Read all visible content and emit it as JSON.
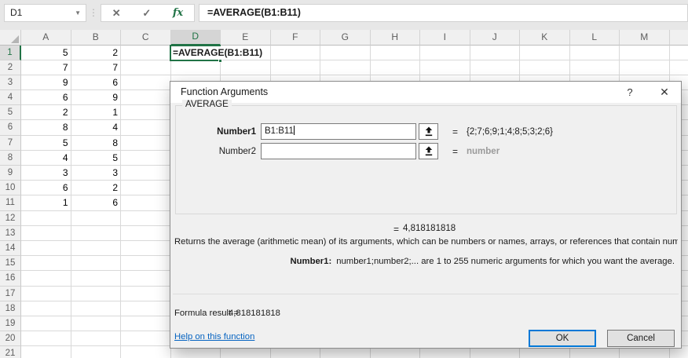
{
  "formula_bar": {
    "name_box": "D1",
    "cancel_icon": "✕",
    "enter_icon": "✓",
    "insert_function_icon": "fx",
    "formula": "=AVERAGE(B1:B11)"
  },
  "grid": {
    "columns": [
      "A",
      "B",
      "C",
      "D",
      "E",
      "F",
      "G",
      "H",
      "I",
      "J",
      "K",
      "L",
      "M"
    ],
    "active_column": "D",
    "active_row": "1",
    "active_cell_text": "=AVERAGE(B1:B11)",
    "rows": [
      {
        "n": "1",
        "a": "5",
        "b": "2"
      },
      {
        "n": "2",
        "a": "7",
        "b": "7"
      },
      {
        "n": "3",
        "a": "9",
        "b": "6"
      },
      {
        "n": "4",
        "a": "6",
        "b": "9"
      },
      {
        "n": "5",
        "a": "2",
        "b": "1"
      },
      {
        "n": "6",
        "a": "8",
        "b": "4"
      },
      {
        "n": "7",
        "a": "5",
        "b": "8"
      },
      {
        "n": "8",
        "a": "4",
        "b": "5"
      },
      {
        "n": "9",
        "a": "3",
        "b": "3"
      },
      {
        "n": "10",
        "a": "6",
        "b": "2"
      },
      {
        "n": "11",
        "a": "1",
        "b": "6"
      },
      {
        "n": "12",
        "a": "",
        "b": ""
      },
      {
        "n": "13",
        "a": "",
        "b": ""
      },
      {
        "n": "14",
        "a": "",
        "b": ""
      },
      {
        "n": "15",
        "a": "",
        "b": ""
      },
      {
        "n": "16",
        "a": "",
        "b": ""
      },
      {
        "n": "17",
        "a": "",
        "b": ""
      },
      {
        "n": "18",
        "a": "",
        "b": ""
      },
      {
        "n": "19",
        "a": "",
        "b": ""
      },
      {
        "n": "20",
        "a": "",
        "b": ""
      },
      {
        "n": "21",
        "a": "",
        "b": ""
      }
    ]
  },
  "dialog": {
    "title": "Function Arguments",
    "help_button": "?",
    "close_button": "✕",
    "group_label": "AVERAGE",
    "fields": {
      "number1": {
        "label": "Number1",
        "value": "B1:B11",
        "equals": "=",
        "result": "{2;7;6;9;1;4;8;5;3;2;6}"
      },
      "number2": {
        "label": "Number2",
        "value": "",
        "equals": "=",
        "result": "number"
      }
    },
    "result_equals": "=",
    "result_value": "4,818181818",
    "description": "Returns the average (arithmetic mean) of its arguments, which can be numbers or names, arrays, or references that contain numbers.",
    "arg_help_label": "Number1:",
    "arg_help_text": "number1;number2;... are 1 to 255 numeric arguments for which you want the average.",
    "formula_result_label": "Formula result =",
    "formula_result_value": "4,818181818",
    "help_link": "Help on this function",
    "ok_label": "OK",
    "cancel_label": "Cancel"
  },
  "colors": {
    "excel_green": "#217346",
    "default_button_border": "#0078d7",
    "link_blue": "#0563c1",
    "dialog_body": "#f0f0f0"
  }
}
